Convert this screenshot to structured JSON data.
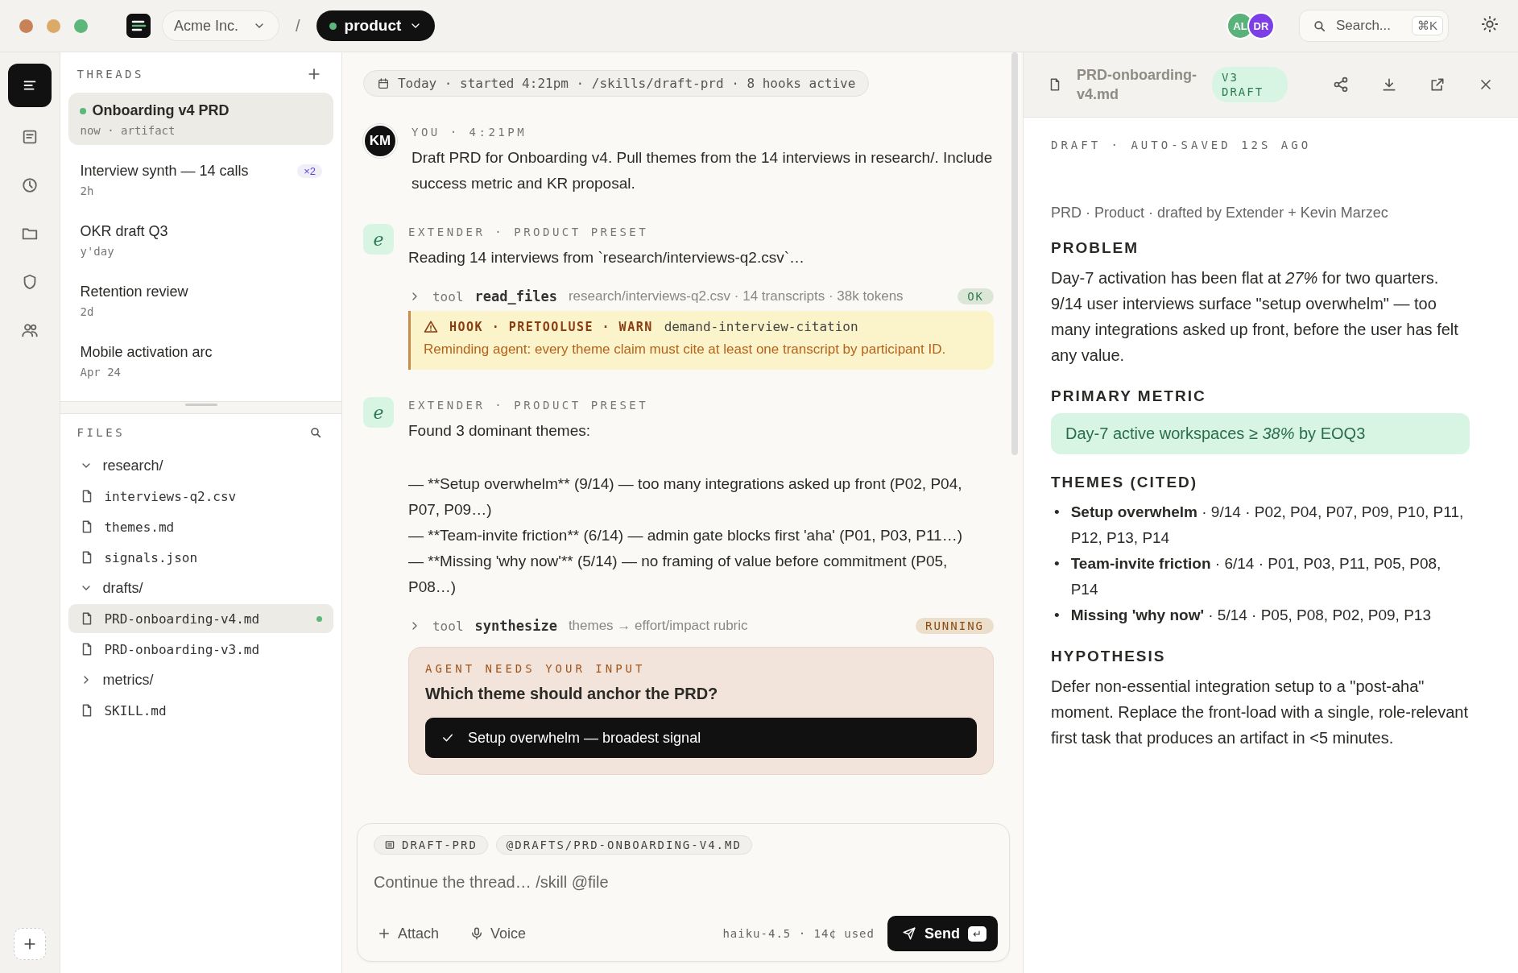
{
  "window": {
    "controls": [
      {
        "color": "#c8825a"
      },
      {
        "color": "#dbaa68"
      },
      {
        "color": "#5cb87a"
      }
    ]
  },
  "topbar": {
    "workspace": "Acme Inc.",
    "separator": "/",
    "project": "product",
    "avatars": [
      {
        "initials": "AL",
        "color": "#58b27a"
      },
      {
        "initials": "DR",
        "color": "#7c3ee6"
      }
    ],
    "search": {
      "placeholder": "Search...",
      "shortcut": "⌘K"
    }
  },
  "rail": {
    "items": [
      {
        "kind": "threads",
        "selected": true
      },
      {
        "kind": "docs",
        "selected": false
      },
      {
        "kind": "history",
        "selected": false
      },
      {
        "kind": "files",
        "selected": false
      },
      {
        "kind": "policies",
        "selected": false
      },
      {
        "kind": "team",
        "selected": false
      }
    ]
  },
  "threads": {
    "title": "THREADS",
    "items": [
      {
        "title": "Onboarding v4 PRD",
        "meta": "now · artifact",
        "selected": true,
        "live": true
      },
      {
        "title": "Interview synth — 14 calls",
        "meta": "2h",
        "badge": "×2",
        "selected": false,
        "live": false
      },
      {
        "title": "OKR draft Q3",
        "meta": "y'day",
        "selected": false,
        "live": false
      },
      {
        "title": "Retention review",
        "meta": "2d",
        "selected": false,
        "live": false
      },
      {
        "title": "Mobile activation arc",
        "meta": "Apr 24",
        "selected": false,
        "live": false
      }
    ]
  },
  "files": {
    "title": "FILES",
    "tree": [
      {
        "kind": "folder",
        "name": "research/",
        "expanded": true,
        "children": [
          {
            "kind": "file",
            "name": "interviews-q2.csv",
            "selected": false,
            "modified": false
          },
          {
            "kind": "file",
            "name": "themes.md",
            "selected": false,
            "modified": false
          },
          {
            "kind": "file",
            "name": "signals.json",
            "selected": false,
            "modified": false
          }
        ]
      },
      {
        "kind": "folder",
        "name": "drafts/",
        "expanded": true,
        "children": [
          {
            "kind": "file",
            "name": "PRD-onboarding-v4.md",
            "selected": true,
            "modified": true
          },
          {
            "kind": "file",
            "name": "PRD-onboarding-v3.md",
            "selected": false,
            "modified": false
          }
        ]
      },
      {
        "kind": "folder",
        "name": "metrics/",
        "expanded": false
      },
      {
        "kind": "file",
        "name": "SKILL.md",
        "selected": false,
        "modified": false
      }
    ]
  },
  "chat": {
    "session": "Today · started 4:21pm · /skills/draft-prd · 8 hooks active",
    "messages": [
      {
        "kind": "user",
        "avatar": "KM",
        "header": "YOU · 4:21PM",
        "paragraphs": [
          "Draft PRD for Onboarding v4. Pull themes from the 14 interviews in research/. Include success metric and KR proposal."
        ]
      },
      {
        "kind": "agent",
        "avatar": "e",
        "header": "EXTENDER · PRODUCT PRESET",
        "paragraphs": [
          "Reading 14 interviews from `research/interviews-q2.csv`…"
        ],
        "blocks": [
          {
            "kind": "tool",
            "label": "tool",
            "name": "read_files",
            "detail": "research/interviews-q2.csv · 14 transcripts · 38k tokens",
            "status": "OK",
            "color": "#2f7a52"
          },
          {
            "kind": "hook",
            "title": "HOOK · PRETOOLUSE · WARN",
            "name": "demand-interview-citation",
            "text": "Reminding agent: every theme claim must cite at least one transcript by participant ID."
          }
        ]
      },
      {
        "kind": "agent",
        "avatar": "e",
        "header": "EXTENDER · PRODUCT PRESET",
        "paragraphs": [
          "Found 3 dominant themes:",
          "— **Setup overwhelm** (9/14) — too many integrations asked up front (P02, P04, P07, P09…)\n— **Team-invite friction** (6/14) — admin gate blocks first 'aha' (P01, P03, P11…)\n— **Missing 'why now'** (5/14) — no framing of value before commitment (P05, P08…)"
        ],
        "blocks": [
          {
            "kind": "tool",
            "label": "tool",
            "name": "synthesize",
            "detail": "themes → effort/impact rubric",
            "status": "RUNNING",
            "color": "#8a4a12"
          },
          {
            "kind": "question",
            "label": "AGENT NEEDS YOUR INPUT",
            "question": "Which theme should anchor the PRD?",
            "options": [
              {
                "text": "Setup overwhelm — broadest signal",
                "selected": true
              }
            ]
          }
        ]
      }
    ]
  },
  "composer": {
    "chips": [
      {
        "kind": "skill",
        "text": "DRAFT-PRD"
      },
      {
        "kind": "file",
        "text": "@DRAFTS/PRD-ONBOARDING-V4.MD"
      }
    ],
    "placeholder": "Continue the thread… /skill @file",
    "actions": [
      {
        "kind": "attach",
        "label": "Attach"
      },
      {
        "kind": "voice",
        "label": "Voice"
      }
    ],
    "usage": "haiku-4.5 · 14¢ used",
    "send": "Send",
    "send_key": "↵"
  },
  "artifact": {
    "title": "PRD-onboarding-v4.md",
    "badge": "V3 DRAFT",
    "status": "DRAFT · AUTO-SAVED 12S AGO",
    "byline": "PRD · Product · drafted by Extender + Kevin Marzec",
    "sections": [
      {
        "kind": "paragraph",
        "heading": "PROBLEM",
        "text": "Day-7 activation has been flat at *27%* for two quarters. 9/14 user interviews surface \"setup overwhelm\" — too many integrations asked up front, before the user has felt any value."
      },
      {
        "kind": "metric",
        "heading": "PRIMARY METRIC",
        "text": "Day-7 active workspaces ≥ *38%* by EOQ3"
      },
      {
        "kind": "list",
        "heading": "THEMES (CITED)",
        "items": [
          {
            "marker": "•",
            "text": "**Setup overwhelm** · 9/14 · P02, P04, P07, P09, P10, P11, P12, P13, P14"
          },
          {
            "marker": "•",
            "text": "**Team-invite friction** · 6/14 · P01, P03, P11, P05, P08, P14"
          },
          {
            "marker": "•",
            "text": "**Missing 'why now'** · 5/14 · P05, P08, P02, P09, P13"
          }
        ]
      },
      {
        "kind": "paragraph",
        "heading": "HYPOTHESIS",
        "text": "Defer non-essential integration setup to a \"post-aha\" moment. Replace the front-load with a single, role-relevant first task that produces an artifact in <5 minutes."
      }
    ]
  }
}
